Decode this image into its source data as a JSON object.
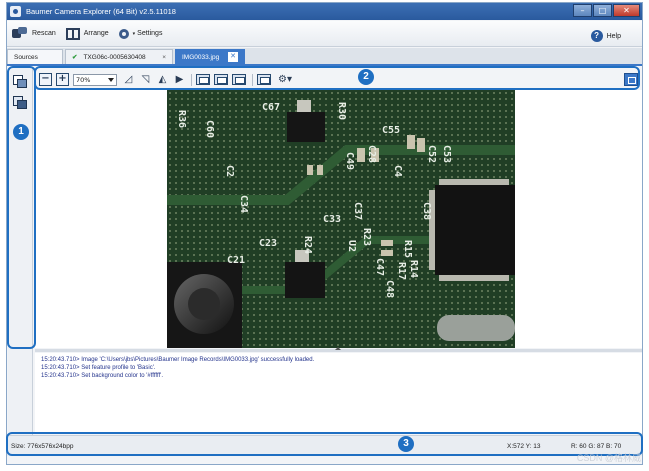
{
  "window": {
    "title": "Baumer Camera Explorer (64 Bit) v2.5.11018"
  },
  "menu": {
    "rescan_label": "Rescan",
    "arrange_label": "Arrange",
    "settings_label": "Settings",
    "help_label": "Help"
  },
  "tabs": [
    {
      "label": "Sources"
    },
    {
      "label": "TXG06c-0005630408"
    },
    {
      "label": "IMG0033.jpg"
    }
  ],
  "image_toolbar": {
    "zoom_value": "70%"
  },
  "image": {
    "labels": [
      "R36",
      "C67",
      "R30",
      "C60",
      "C55",
      "C49",
      "C28",
      "C52",
      "C53",
      "C34",
      "C4",
      "C2",
      "C38",
      "C33",
      "C37",
      "R23",
      "R24",
      "C23",
      "U2",
      "C21",
      "R15",
      "R14",
      "R17",
      "C47",
      "C48"
    ]
  },
  "log": [
    "15:20:43.710> Image 'C:\\Users\\jbs\\Pictures\\Baumer Image Records\\IMG0033.jpg' successfully loaded.",
    "15:20:43.710> Set feature profile to 'Basic'.",
    "15:20:43.710> Set background color to '#ffffff'."
  ],
  "status": {
    "size": "Size: 776x576x24bpp",
    "xy": "X:572 Y: 13",
    "rgb": "R: 60 G: 87 B: 70"
  },
  "callouts": [
    "1",
    "2",
    "3"
  ],
  "watermark": "CSDN @格林威",
  "colors": {
    "accent": "#1f6fc2",
    "tab_active": "#3c78c8",
    "log_text": "#23338c"
  }
}
